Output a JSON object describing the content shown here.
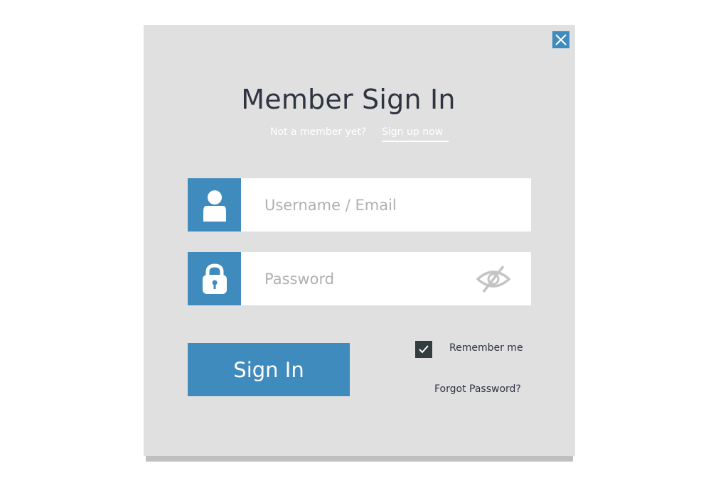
{
  "dialog": {
    "title": "Member Sign In",
    "not_member_text": "Not a member yet?",
    "signup_link": "Sign up now",
    "close_icon": "close-icon"
  },
  "form": {
    "username": {
      "placeholder": "Username / Email",
      "value": "",
      "icon": "user-icon"
    },
    "password": {
      "placeholder": "Password",
      "value": "",
      "icon": "lock-icon",
      "toggle_icon": "eye-slash-icon"
    },
    "signin_label": "Sign In",
    "remember_label": "Remember me",
    "remember_checked": true,
    "forgot_label": "Forgot Password?"
  },
  "colors": {
    "accent": "#3f8bbd",
    "panel": "#e0e0e0",
    "title": "#2e3440",
    "checkbox": "#333d3f"
  }
}
